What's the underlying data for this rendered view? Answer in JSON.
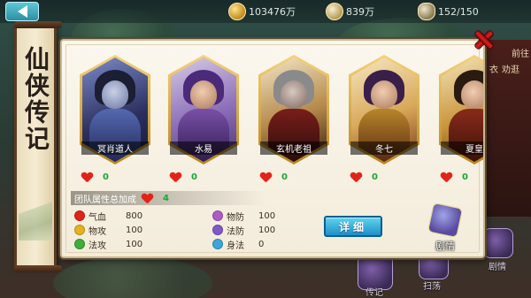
{
  "resources": [
    {
      "icon": "gold-coin-icon",
      "value": "103476万"
    },
    {
      "icon": "silver-ingot-icon",
      "value": "839万"
    },
    {
      "icon": "bag-icon",
      "value": "152/150"
    }
  ],
  "scroll": {
    "title": "仙侠传记"
  },
  "heroes": [
    {
      "name": "冥肖道人",
      "favor": "0"
    },
    {
      "name": "水易",
      "favor": "0"
    },
    {
      "name": "玄机老祖",
      "favor": "0"
    },
    {
      "name": "冬七",
      "favor": "0"
    },
    {
      "name": "夏皇",
      "favor": "0"
    }
  ],
  "bonus": {
    "label": "团队属性总加成",
    "count": "4",
    "stats": [
      {
        "label": "气血",
        "value": "800",
        "color": "#e2231a"
      },
      {
        "label": "物攻",
        "value": "100",
        "color": "#e6b21e"
      },
      {
        "label": "法攻",
        "value": "100",
        "color": "#3fae3a"
      },
      {
        "label": "物防",
        "value": "100",
        "color": "#b05ac8"
      },
      {
        "label": "法防",
        "value": "100",
        "color": "#7d5ac8"
      },
      {
        "label": "身法",
        "value": "0",
        "color": "#3aa7d8"
      }
    ]
  },
  "buttons": {
    "detail": "详细",
    "story": "剧情"
  },
  "background": {
    "right_texts": [
      "前往",
      "衣",
      "劝逛"
    ],
    "bottom_labels": [
      "传记",
      "扫荡",
      "剧情"
    ]
  },
  "colors": {
    "accent": "#1f8fc8",
    "heart": "#e2231a",
    "favor": "#19a63a",
    "panel": "#fbf7ee"
  }
}
